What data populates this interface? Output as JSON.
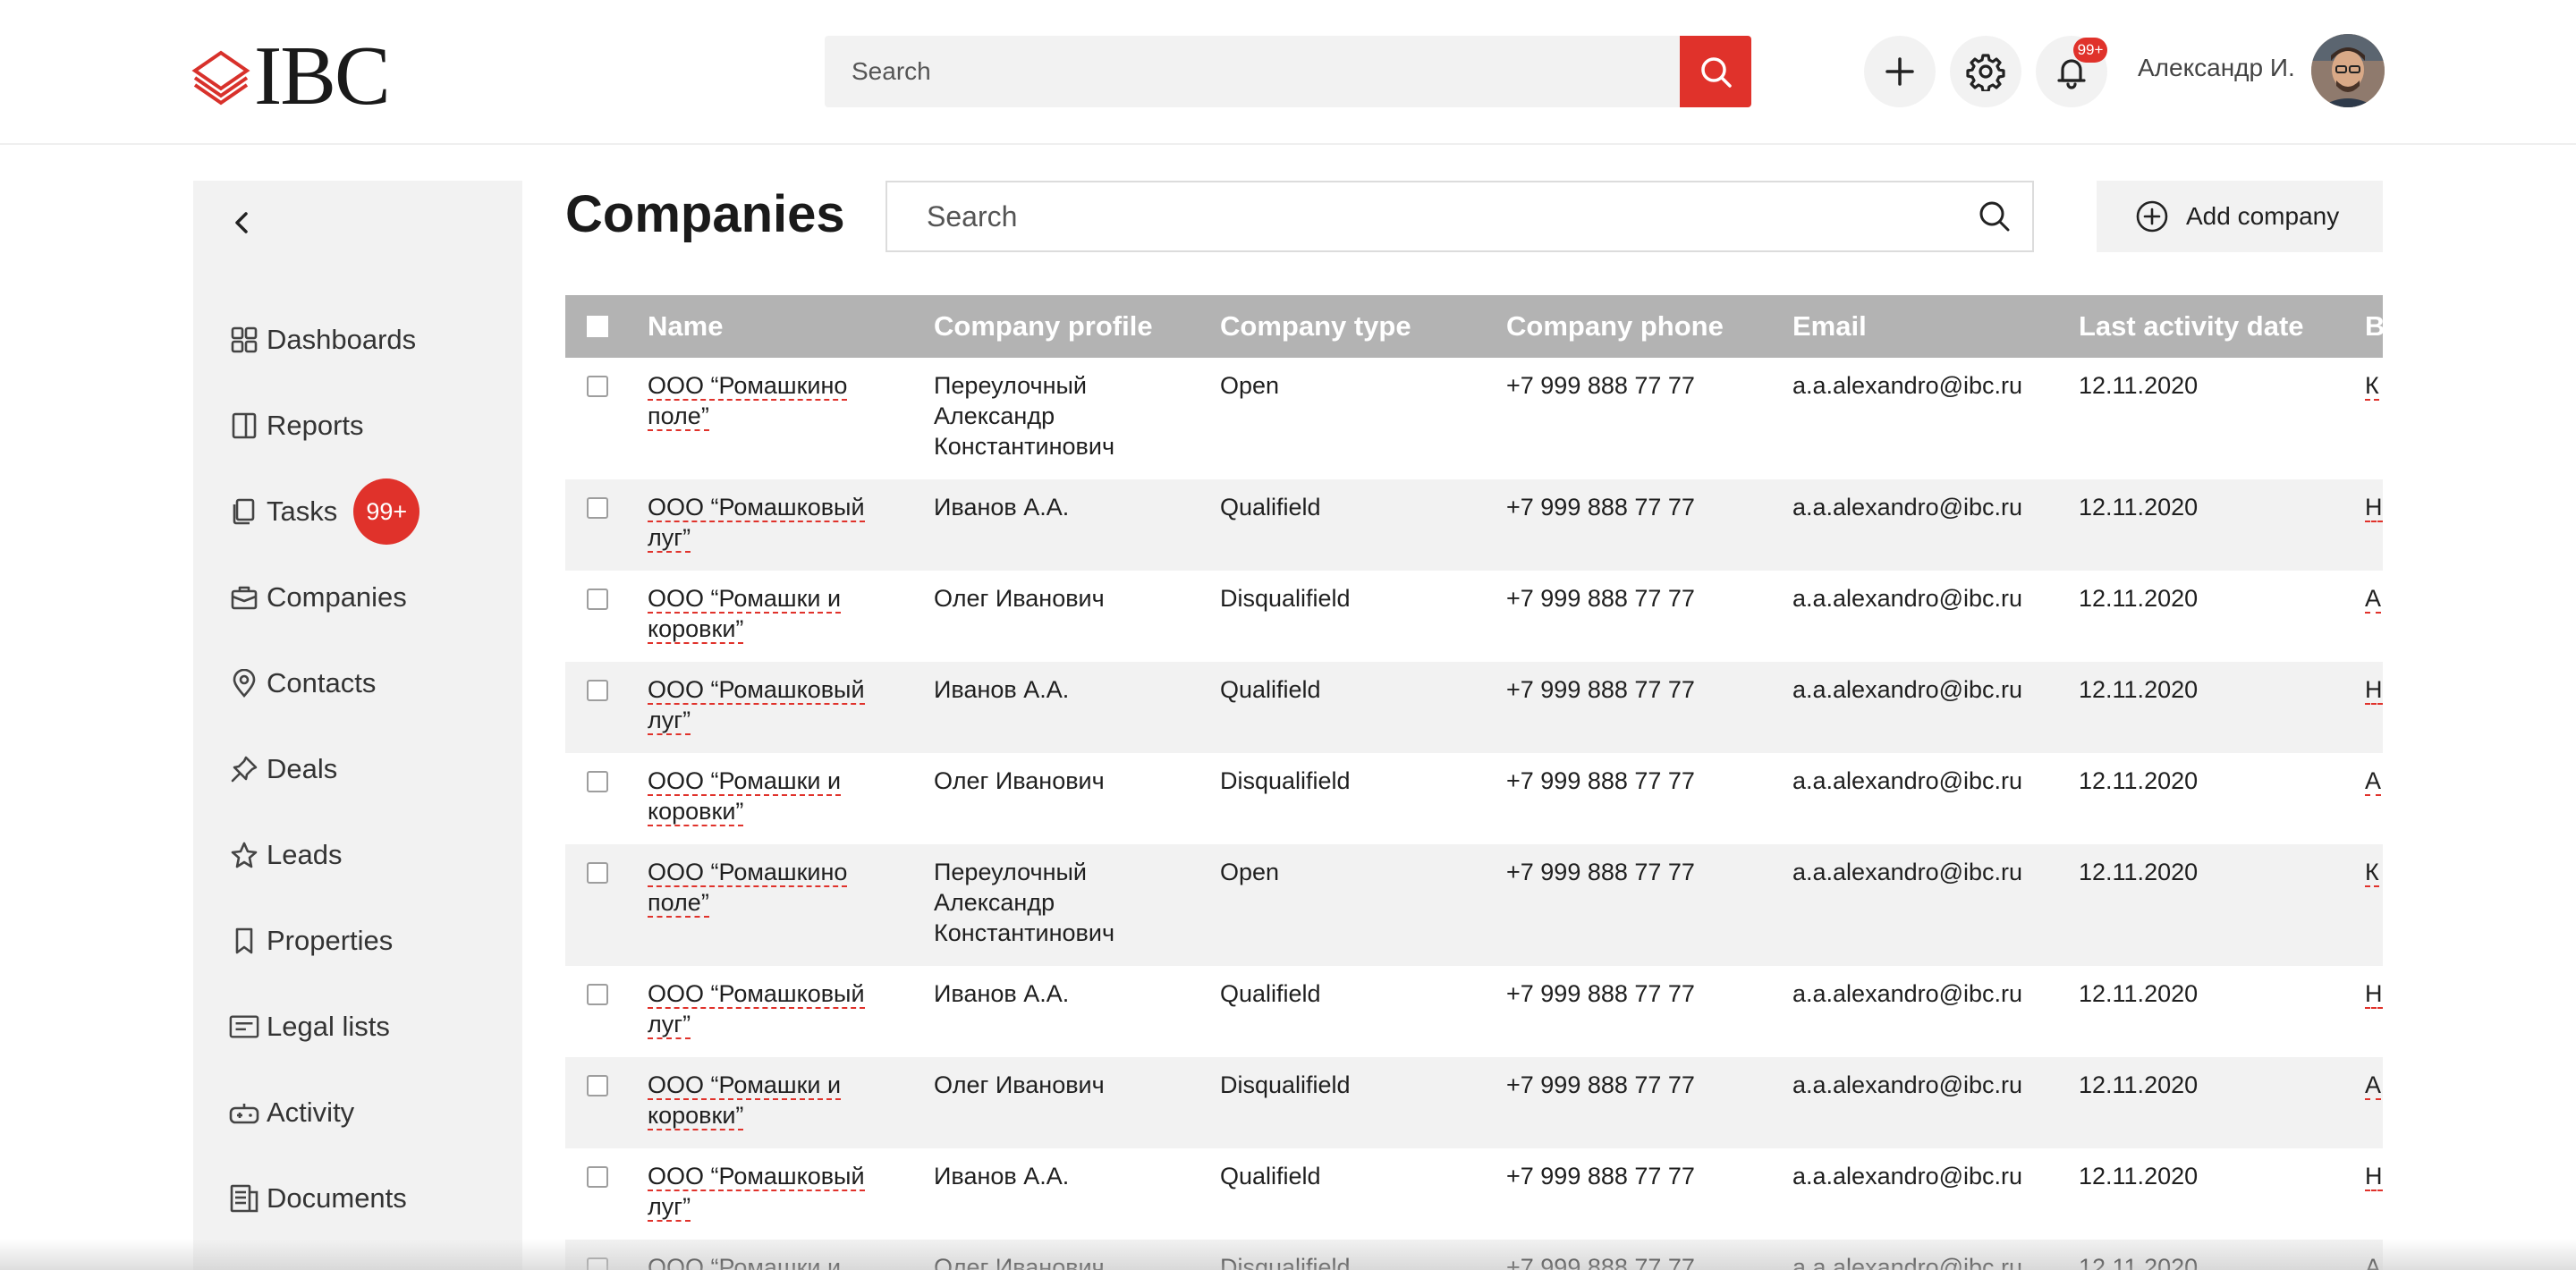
{
  "header": {
    "logo_text": "IBC",
    "search_placeholder": "Search",
    "notifications_badge": "99+",
    "user_name": "Александр И."
  },
  "sidebar": {
    "items": [
      {
        "label": "Dashboards",
        "icon": "dashboard-icon"
      },
      {
        "label": "Reports",
        "icon": "report-icon"
      },
      {
        "label": "Tasks",
        "icon": "tasks-icon",
        "badge": "99+"
      },
      {
        "label": "Companies",
        "icon": "briefcase-icon"
      },
      {
        "label": "Contacts",
        "icon": "location-pin-icon"
      },
      {
        "label": "Deals",
        "icon": "pin-icon"
      },
      {
        "label": "Leads",
        "icon": "star-icon"
      },
      {
        "label": "Properties",
        "icon": "bookmark-icon"
      },
      {
        "label": "Legal lists",
        "icon": "legal-card-icon"
      },
      {
        "label": "Activity",
        "icon": "gamepad-icon"
      },
      {
        "label": "Documents",
        "icon": "documents-icon"
      }
    ]
  },
  "main": {
    "title": "Companies",
    "search_placeholder": "Search",
    "add_button_label": "Add company",
    "table": {
      "columns": [
        "Name",
        "Company profile",
        "Company type",
        "Company phone",
        "Email",
        "Last activity date",
        "B"
      ],
      "rows": [
        {
          "name": "ООО “Ромашкино поле”",
          "profile": "Переулочный Александр Константинович",
          "type": "Open",
          "phone": "+7 999 888 77 77",
          "email": "a.a.alexandro@ibc.ru",
          "date": "12.11.2020",
          "extra": "К"
        },
        {
          "name": "ООО “Ромашковый луг”",
          "profile": "Иванов А.А.",
          "type": "Qualifield",
          "phone": "+7 999 888 77 77",
          "email": "a.a.alexandro@ibc.ru",
          "date": "12.11.2020",
          "extra": "Н"
        },
        {
          "name": "ООО “Ромашки и коровки”",
          "profile": "Олег Иванович",
          "type": "Disqualifield",
          "phone": "+7 999 888 77 77",
          "email": "a.a.alexandro@ibc.ru",
          "date": "12.11.2020",
          "extra": "А"
        },
        {
          "name": "ООО “Ромашковый луг”",
          "profile": "Иванов А.А.",
          "type": "Qualifield",
          "phone": "+7 999 888 77 77",
          "email": "a.a.alexandro@ibc.ru",
          "date": "12.11.2020",
          "extra": "Н"
        },
        {
          "name": "ООО “Ромашки и коровки”",
          "profile": "Олег Иванович",
          "type": "Disqualifield",
          "phone": "+7 999 888 77 77",
          "email": "a.a.alexandro@ibc.ru",
          "date": "12.11.2020",
          "extra": "А"
        },
        {
          "name": "ООО “Ромашкино поле”",
          "profile": "Переулочный Александр Константинович",
          "type": "Open",
          "phone": "+7 999 888 77 77",
          "email": "a.a.alexandro@ibc.ru",
          "date": "12.11.2020",
          "extra": "К"
        },
        {
          "name": "ООО “Ромашковый луг”",
          "profile": "Иванов А.А.",
          "type": "Qualifield",
          "phone": "+7 999 888 77 77",
          "email": "a.a.alexandro@ibc.ru",
          "date": "12.11.2020",
          "extra": "Н"
        },
        {
          "name": "ООО “Ромашки и коровки”",
          "profile": "Олег Иванович",
          "type": "Disqualifield",
          "phone": "+7 999 888 77 77",
          "email": "a.a.alexandro@ibc.ru",
          "date": "12.11.2020",
          "extra": "А"
        },
        {
          "name": "ООО “Ромашковый луг”",
          "profile": "Иванов А.А.",
          "type": "Qualifield",
          "phone": "+7 999 888 77 77",
          "email": "a.a.alexandro@ibc.ru",
          "date": "12.11.2020",
          "extra": "Н"
        },
        {
          "name": "ООО “Ромашки и коровки”",
          "profile": "Олег Иванович",
          "type": "Disqualifield",
          "phone": "+7 999 888 77 77",
          "email": "a.a.alexandro@ibc.ru",
          "date": "12.11.2020",
          "extra": "А"
        }
      ]
    }
  },
  "colors": {
    "accent": "#e0322b",
    "table_header": "#b3b3b3",
    "sidebar_bg": "#f2f2f2"
  }
}
